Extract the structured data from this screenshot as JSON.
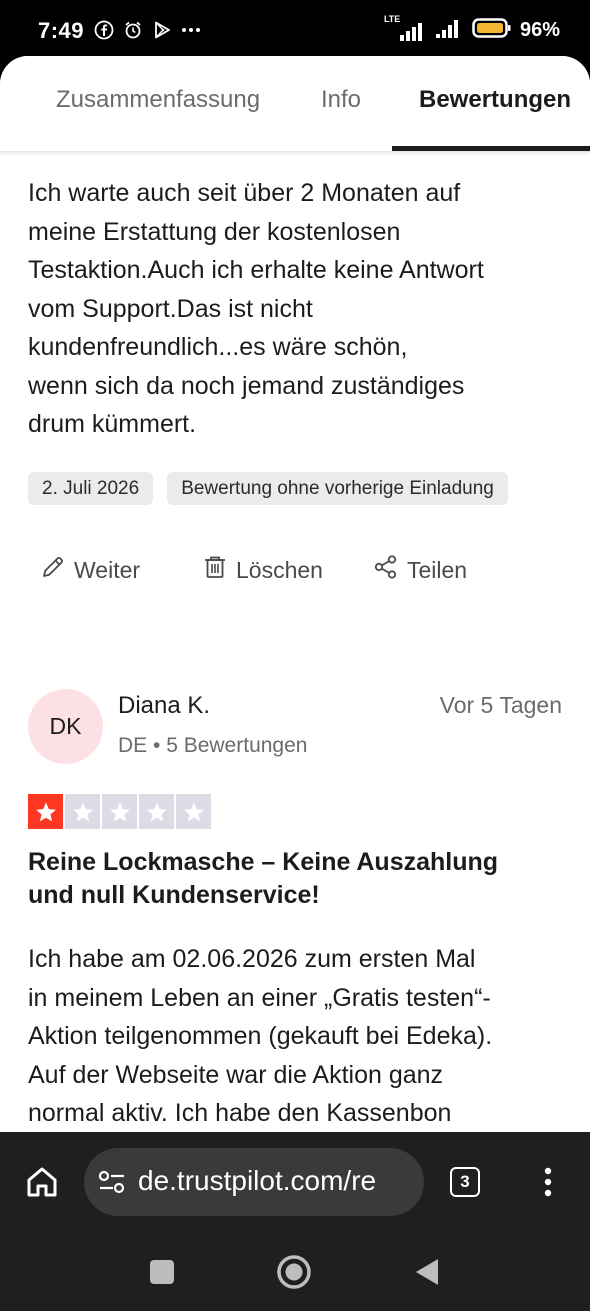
{
  "status_bar": {
    "time": "7:49",
    "network": "LTE",
    "battery": "96%",
    "icons": [
      "facebook-icon",
      "alarm-icon",
      "play-store-icon",
      "more-dots-icon",
      "signal-icon",
      "battery-icon"
    ]
  },
  "tabs": [
    {
      "label": "Zusammenfassung",
      "active": false
    },
    {
      "label": "Info",
      "active": false
    },
    {
      "label": "Bewertungen",
      "active": true
    }
  ],
  "first_review": {
    "text": "Ich warte auch seit über 2 Monaten auf\nmeine Erstattung der kostenlosen\nTestaktion.Auch ich erhalte keine Antwort\nvom Support.Das ist nicht\nkundenfreundlich...es wäre schön,\nwenn sich da noch jemand zuständiges\ndrum kümmert.",
    "date_chip": "2. Juli 2026",
    "tag_chip": "Bewertung ohne vorherige Einladung",
    "actions": {
      "edit": "Weiter",
      "delete": "Löschen",
      "share": "Teilen"
    }
  },
  "second_review": {
    "initials": "DK",
    "name": "Diana K.",
    "meta": "DE • 5 Bewertungen",
    "date": "Vor 5 Tagen",
    "rating": 1,
    "rating_max": 5,
    "title": "Reine Lockmasche – Keine Auszahlung\nund null Kundenservice!",
    "text": "Ich habe am 02.06.2026 zum ersten Mal\nin meinem Leben an einer „Gratis testen“-\nAktion teilgenommen (gekauft bei Edeka).\nAuf der Webseite war die Aktion ganz\nnormal aktiv. Ich habe den Kassenbon"
  },
  "browser": {
    "url": "de.trustpilot.com/re",
    "tab_count": "3"
  },
  "colors": {
    "star_filled": "#ff3722",
    "star_empty": "#dcdce6",
    "avatar_bg": "#fde0e4",
    "chip_bg": "#ebebeb"
  }
}
